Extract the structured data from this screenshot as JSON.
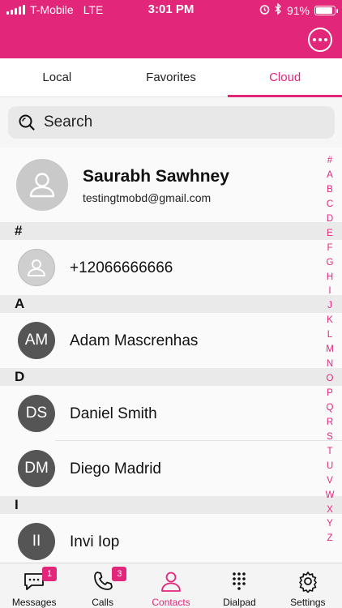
{
  "status_bar": {
    "carrier": "T-Mobile",
    "network": "LTE",
    "time": "3:01 PM",
    "battery": "91%",
    "battery_level": 0.91,
    "icons": [
      "signal-icon",
      "alarm-icon",
      "bluetooth-icon",
      "battery-icon"
    ]
  },
  "header": {
    "more_icon": "more-horizontal-icon"
  },
  "tabs": [
    {
      "label": "Local",
      "active": false
    },
    {
      "label": "Favorites",
      "active": false
    },
    {
      "label": "Cloud",
      "active": true
    }
  ],
  "search": {
    "placeholder": "Search",
    "icon": "search-icon"
  },
  "my_card": {
    "name": "Saurabh Sawhney",
    "email": "testingtmobd@gmail.com"
  },
  "sections": [
    {
      "letter": "#",
      "contacts": [
        {
          "initials": "",
          "name": "+12066666666"
        }
      ]
    },
    {
      "letter": "A",
      "contacts": [
        {
          "initials": "AM",
          "name": "Adam Mascrenhas"
        }
      ]
    },
    {
      "letter": "D",
      "contacts": [
        {
          "initials": "DS",
          "name": "Daniel Smith"
        },
        {
          "initials": "DM",
          "name": "Diego Madrid"
        }
      ]
    },
    {
      "letter": "I",
      "contacts": [
        {
          "initials": "II",
          "name": "Invi Iop"
        }
      ]
    }
  ],
  "alphabet_index": [
    "#",
    "A",
    "B",
    "C",
    "D",
    "E",
    "F",
    "G",
    "H",
    "I",
    "J",
    "K",
    "L",
    "M",
    "N",
    "O",
    "P",
    "Q",
    "R",
    "S",
    "T",
    "U",
    "V",
    "W",
    "X",
    "Y",
    "Z"
  ],
  "bottom_nav": [
    {
      "label": "Messages",
      "icon": "messages-icon",
      "badge": "1",
      "active": false
    },
    {
      "label": "Calls",
      "icon": "phone-icon",
      "badge": "3",
      "active": false
    },
    {
      "label": "Contacts",
      "icon": "contacts-icon",
      "badge": "",
      "active": true
    },
    {
      "label": "Dialpad",
      "icon": "dialpad-icon",
      "badge": "",
      "active": false
    },
    {
      "label": "Settings",
      "icon": "gear-icon",
      "badge": "",
      "active": false
    }
  ],
  "colors": {
    "accent": "#e2277a",
    "avatar_dark": "#555555",
    "section_bg": "#eaeaea"
  }
}
